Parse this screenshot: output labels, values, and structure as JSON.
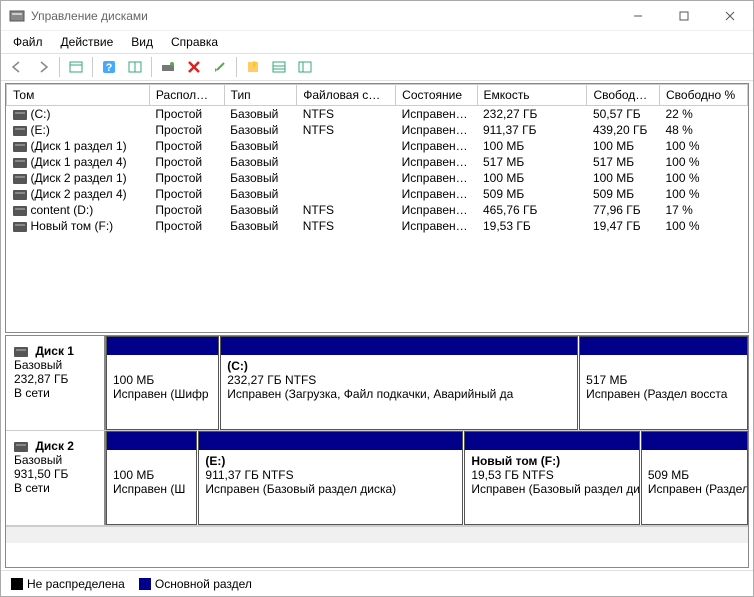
{
  "window": {
    "title": "Управление дисками"
  },
  "menu": {
    "file": "Файл",
    "action": "Действие",
    "view": "Вид",
    "help": "Справка"
  },
  "columns": {
    "volume": "Том",
    "layout": "Распол…",
    "type": "Тип",
    "fs": "Файловая с…",
    "status": "Состояние",
    "capacity": "Емкость",
    "free": "Свобод…",
    "freepct": "Свободно %"
  },
  "col_widths": {
    "volume": 130,
    "layout": 68,
    "type": 66,
    "fs": 90,
    "status": 74,
    "capacity": 100,
    "free": 66,
    "freepct": 80
  },
  "volumes": [
    {
      "name": "(C:)",
      "layout": "Простой",
      "type": "Базовый",
      "fs": "NTFS",
      "status": "Исправен…",
      "capacity": "232,27 ГБ",
      "free": "50,57 ГБ",
      "freepct": "22 %"
    },
    {
      "name": "(E:)",
      "layout": "Простой",
      "type": "Базовый",
      "fs": "NTFS",
      "status": "Исправен…",
      "capacity": "911,37 ГБ",
      "free": "439,20 ГБ",
      "freepct": "48 %"
    },
    {
      "name": "(Диск 1 раздел 1)",
      "layout": "Простой",
      "type": "Базовый",
      "fs": "",
      "status": "Исправен…",
      "capacity": "100 МБ",
      "free": "100 МБ",
      "freepct": "100 %"
    },
    {
      "name": "(Диск 1 раздел 4)",
      "layout": "Простой",
      "type": "Базовый",
      "fs": "",
      "status": "Исправен…",
      "capacity": "517 МБ",
      "free": "517 МБ",
      "freepct": "100 %"
    },
    {
      "name": "(Диск 2 раздел 1)",
      "layout": "Простой",
      "type": "Базовый",
      "fs": "",
      "status": "Исправен…",
      "capacity": "100 МБ",
      "free": "100 МБ",
      "freepct": "100 %"
    },
    {
      "name": "(Диск 2 раздел 4)",
      "layout": "Простой",
      "type": "Базовый",
      "fs": "",
      "status": "Исправен…",
      "capacity": "509 МБ",
      "free": "509 МБ",
      "freepct": "100 %"
    },
    {
      "name": "content (D:)",
      "layout": "Простой",
      "type": "Базовый",
      "fs": "NTFS",
      "status": "Исправен…",
      "capacity": "465,76 ГБ",
      "free": "77,96 ГБ",
      "freepct": "17 %"
    },
    {
      "name": "Новый том (F:)",
      "layout": "Простой",
      "type": "Базовый",
      "fs": "NTFS",
      "status": "Исправен…",
      "capacity": "19,53 ГБ",
      "free": "19,47 ГБ",
      "freepct": "100 %"
    }
  ],
  "disks": [
    {
      "name": "Диск 1",
      "type": "Базовый",
      "capacity": "232,87 ГБ",
      "status": "В сети",
      "parts": [
        {
          "name": "",
          "size": "100 МБ",
          "status": "Исправен (Шифр",
          "flex": 1
        },
        {
          "name": "(C:)",
          "size": "232,27 ГБ NTFS",
          "status": "Исправен (Загрузка, Файл подкачки, Аварийный да",
          "flex": 3.2
        },
        {
          "name": "",
          "size": "517 МБ",
          "status": "Исправен (Раздел восста",
          "flex": 1.5
        }
      ]
    },
    {
      "name": "Диск 2",
      "type": "Базовый",
      "capacity": "931,50 ГБ",
      "status": "В сети",
      "parts": [
        {
          "name": "",
          "size": "100 МБ",
          "status": "Исправен (Ш",
          "flex": 0.85
        },
        {
          "name": "(E:)",
          "size": "911,37 ГБ NTFS",
          "status": "Исправен (Базовый раздел диска)",
          "flex": 2.5
        },
        {
          "name": "Новый том  (F:)",
          "size": "19,53 ГБ NTFS",
          "status": "Исправен (Базовый раздел ди",
          "flex": 1.65
        },
        {
          "name": "",
          "size": "509 МБ",
          "status": "Исправен (Раздел",
          "flex": 1
        }
      ]
    }
  ],
  "legend": {
    "unalloc": "Не распределена",
    "primary": "Основной раздел"
  }
}
